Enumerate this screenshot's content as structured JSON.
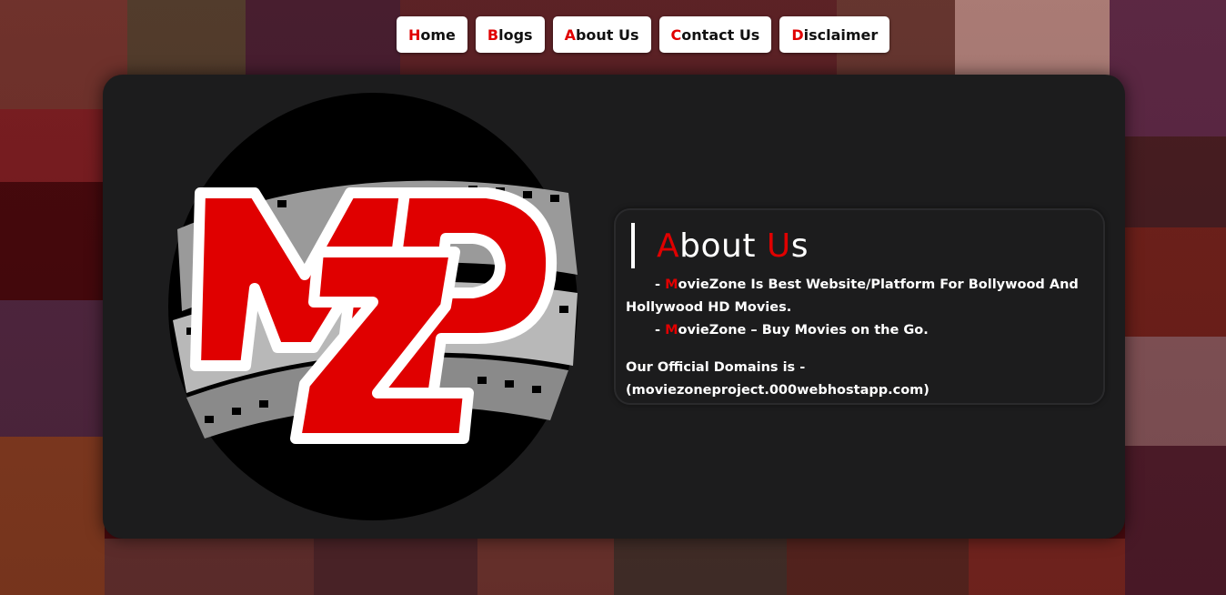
{
  "nav": {
    "items": [
      {
        "initial": "H",
        "rest": "ome"
      },
      {
        "initial": "B",
        "rest": "logs"
      },
      {
        "initial": "A",
        "rest": "bout Us"
      },
      {
        "initial": "C",
        "rest": "ontact Us"
      },
      {
        "initial": "D",
        "rest": "isclaimer"
      }
    ]
  },
  "about": {
    "title_a": "A",
    "title_mid": "bout ",
    "title_u": "U",
    "title_end": "s",
    "line1_dash": "- ",
    "line1_mark": "M",
    "line1_rest": "ovieZone Is Best Website/Platform For Bollywood And",
    "line1_cont": "Hollywood HD Movies.",
    "line2_dash": "- ",
    "line2_mark": "M",
    "line2_rest": "ovieZone – Buy Movies on the Go.",
    "domains": "Our Official Domains is - (moviezoneproject.000webhostapp.com)"
  },
  "logo": {
    "letters": "MZP",
    "icon": "film-reel-logo"
  },
  "colors": {
    "accent": "#e00000",
    "card": "#1c1c1d",
    "nav_bg": "#ffffff"
  }
}
